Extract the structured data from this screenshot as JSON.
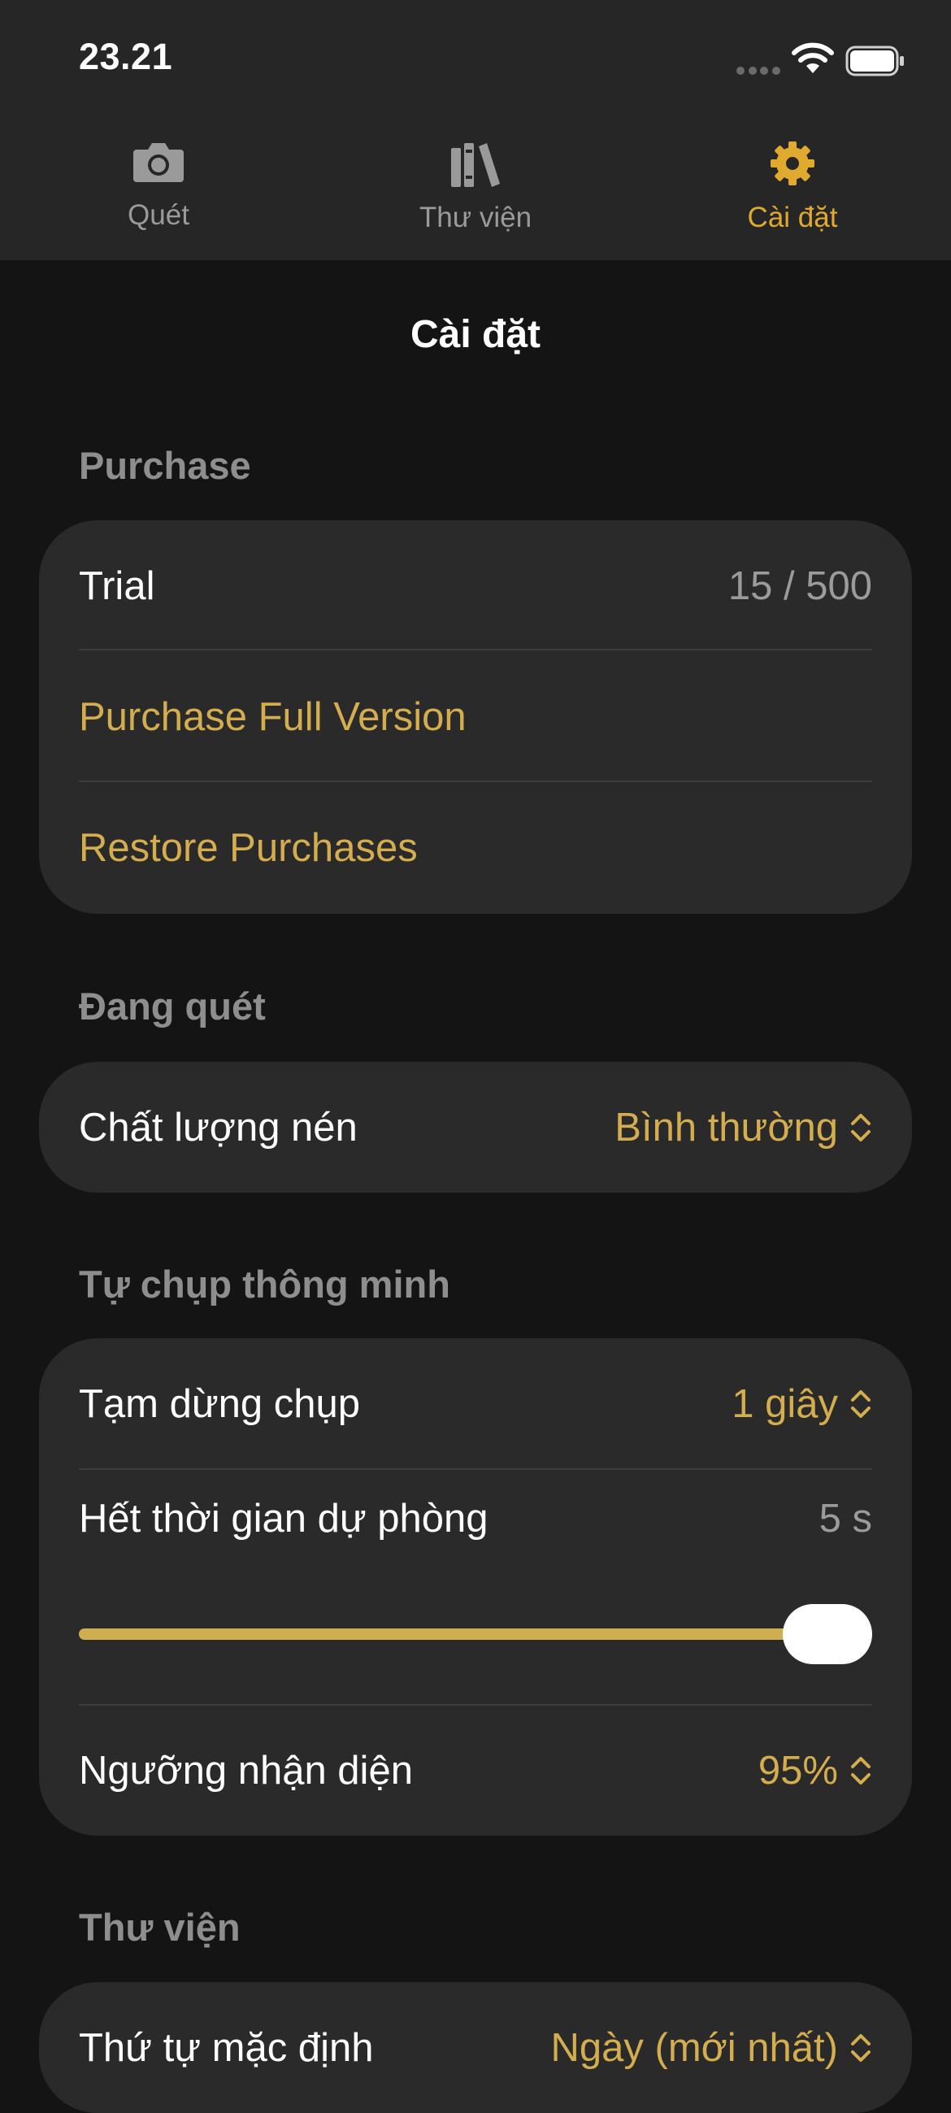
{
  "status_bar": {
    "time": "23.21"
  },
  "tabs": [
    {
      "label": "Quét",
      "icon": "camera-icon",
      "active": false
    },
    {
      "label": "Thư viện",
      "icon": "library-icon",
      "active": false
    },
    {
      "label": "Cài đặt",
      "icon": "gear-icon",
      "active": true
    }
  ],
  "nav": {
    "title": "Cài đặt"
  },
  "colors": {
    "accent": "#d4ad4f",
    "tab_active": "#e0aa2e",
    "background": "#141414",
    "card": "#2a2a2a"
  },
  "purchase": {
    "header": "Purchase",
    "trial_label": "Trial",
    "trial_value": "15 / 500",
    "buy_label": "Purchase Full Version",
    "restore_label": "Restore Purchases"
  },
  "scanning": {
    "header": "Đang quét",
    "compression_label": "Chất lượng nén",
    "compression_value": "Bình thường"
  },
  "smart_capture": {
    "header": "Tự chụp thông minh",
    "pause_label": "Tạm dừng chụp",
    "pause_value": "1 giây",
    "timeout_label": "Hết thời gian dự phòng",
    "timeout_value": "5 s",
    "timeout_slider_fraction": 1.0,
    "threshold_label": "Ngưỡng nhận diện",
    "threshold_value": "95%"
  },
  "library": {
    "header": "Thư viện",
    "order_label": "Thứ tự mặc định",
    "order_value": "Ngày (mới nhất)"
  }
}
